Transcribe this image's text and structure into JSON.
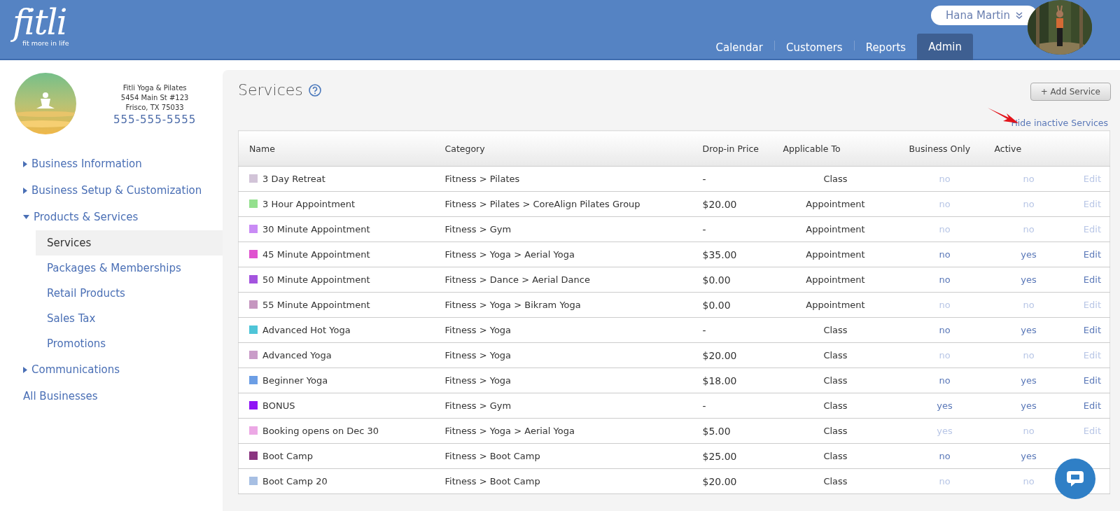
{
  "header": {
    "logo": {
      "wordmark": "fitli",
      "tagline": "fit more in life"
    },
    "user_menu": {
      "label": "Hana Martin"
    },
    "nav": [
      {
        "label": "Calendar",
        "selected": false
      },
      {
        "label": "Customers",
        "selected": false
      },
      {
        "label": "Reports",
        "selected": false
      },
      {
        "label": "Admin",
        "selected": true
      }
    ]
  },
  "business": {
    "name": "Fitli Yoga & Pilates",
    "address_line_1": "5454 Main St #123",
    "address_line_2": "Frisco, TX 75033",
    "phone": "555-555-5555"
  },
  "sidebar": {
    "items": [
      {
        "label": "Business Information",
        "kind": "group",
        "expanded": false
      },
      {
        "label": "Business Setup & Customization",
        "kind": "group",
        "expanded": false
      },
      {
        "label": "Products & Services",
        "kind": "group",
        "expanded": true,
        "children": [
          {
            "label": "Services",
            "selected": true
          },
          {
            "label": "Packages & Memberships",
            "selected": false
          },
          {
            "label": "Retail Products",
            "selected": false
          },
          {
            "label": "Sales Tax",
            "selected": false
          },
          {
            "label": "Promotions",
            "selected": false
          }
        ]
      },
      {
        "label": "Communications",
        "kind": "group",
        "expanded": false
      },
      {
        "label": "All Businesses",
        "kind": "link"
      }
    ]
  },
  "page": {
    "title": "Services",
    "add_button": "+ Add Service",
    "toggle_link": "Hide inactive Services"
  },
  "table": {
    "columns": [
      "Name",
      "Category",
      "Drop-in Price",
      "Applicable To",
      "Business Only",
      "Active"
    ],
    "rows": [
      {
        "color": "#d2c4d8",
        "name": "3 Day Retreat",
        "category": "Fitness > Pilates",
        "price": "-",
        "applicable_to": "Class",
        "business_only": "no",
        "active": "no",
        "disabled": true,
        "edit": "Edit"
      },
      {
        "color": "#94e08e",
        "name": "3 Hour Appointment",
        "category": "Fitness > Pilates > CoreAlign Pilates Group",
        "price": "$20.00",
        "applicable_to": "Appointment",
        "business_only": "no",
        "active": "no",
        "disabled": true,
        "edit": "Edit"
      },
      {
        "color": "#c98bf5",
        "name": "30 Minute Appointment",
        "category": "Fitness > Gym",
        "price": "-",
        "applicable_to": "Appointment",
        "business_only": "no",
        "active": "no",
        "disabled": true,
        "edit": "Edit"
      },
      {
        "color": "#df52cf",
        "name": "45 Minute Appointment",
        "category": "Fitness > Yoga > Aerial Yoga",
        "price": "$35.00",
        "applicable_to": "Appointment",
        "business_only": "no",
        "active": "yes",
        "disabled": false,
        "edit": "Edit"
      },
      {
        "color": "#a454df",
        "name": "50 Minute Appointment",
        "category": "Fitness > Dance > Aerial Dance",
        "price": "$0.00",
        "applicable_to": "Appointment",
        "business_only": "no",
        "active": "yes",
        "disabled": false,
        "edit": "Edit"
      },
      {
        "color": "#c596bf",
        "name": "55 Minute Appointment",
        "category": "Fitness > Yoga > Bikram Yoga",
        "price": "$0.00",
        "applicable_to": "Appointment",
        "business_only": "no",
        "active": "no",
        "disabled": true,
        "edit": "Edit"
      },
      {
        "color": "#4fc5d8",
        "name": "Advanced Hot Yoga",
        "category": "Fitness > Yoga",
        "price": "-",
        "applicable_to": "Class",
        "business_only": "no",
        "active": "yes",
        "disabled": false,
        "edit": "Edit"
      },
      {
        "color": "#c99cc8",
        "name": "Advanced Yoga",
        "category": "Fitness > Yoga",
        "price": "$20.00",
        "applicable_to": "Class",
        "business_only": "no",
        "active": "no",
        "disabled": true,
        "edit": "Edit"
      },
      {
        "color": "#6c9ee5",
        "name": "Beginner Yoga",
        "category": "Fitness > Yoga",
        "price": "$18.00",
        "applicable_to": "Class",
        "business_only": "no",
        "active": "yes",
        "disabled": false,
        "edit": "Edit"
      },
      {
        "color": "#8f14f5",
        "name": "BONUS",
        "category": "Fitness > Gym",
        "price": "-",
        "applicable_to": "Class",
        "business_only": "yes",
        "active": "yes",
        "disabled": false,
        "edit": "Edit"
      },
      {
        "color": "#eca8e5",
        "name": "Booking opens on Dec 30",
        "category": "Fitness > Yoga > Aerial Yoga",
        "price": "$5.00",
        "applicable_to": "Class",
        "business_only": "yes",
        "active": "no",
        "disabled": true,
        "edit": "Edit"
      },
      {
        "color": "#8a3580",
        "name": "Boot Camp",
        "category": "Fitness > Boot Camp",
        "price": "$25.00",
        "applicable_to": "Class",
        "business_only": "no",
        "active": "yes",
        "disabled": false
      },
      {
        "color": "#a7bfe3",
        "name": "Boot Camp 20",
        "category": "Fitness > Boot Camp",
        "price": "$20.00",
        "applicable_to": "Class",
        "business_only": "no",
        "active": "no",
        "disabled": true
      }
    ]
  }
}
